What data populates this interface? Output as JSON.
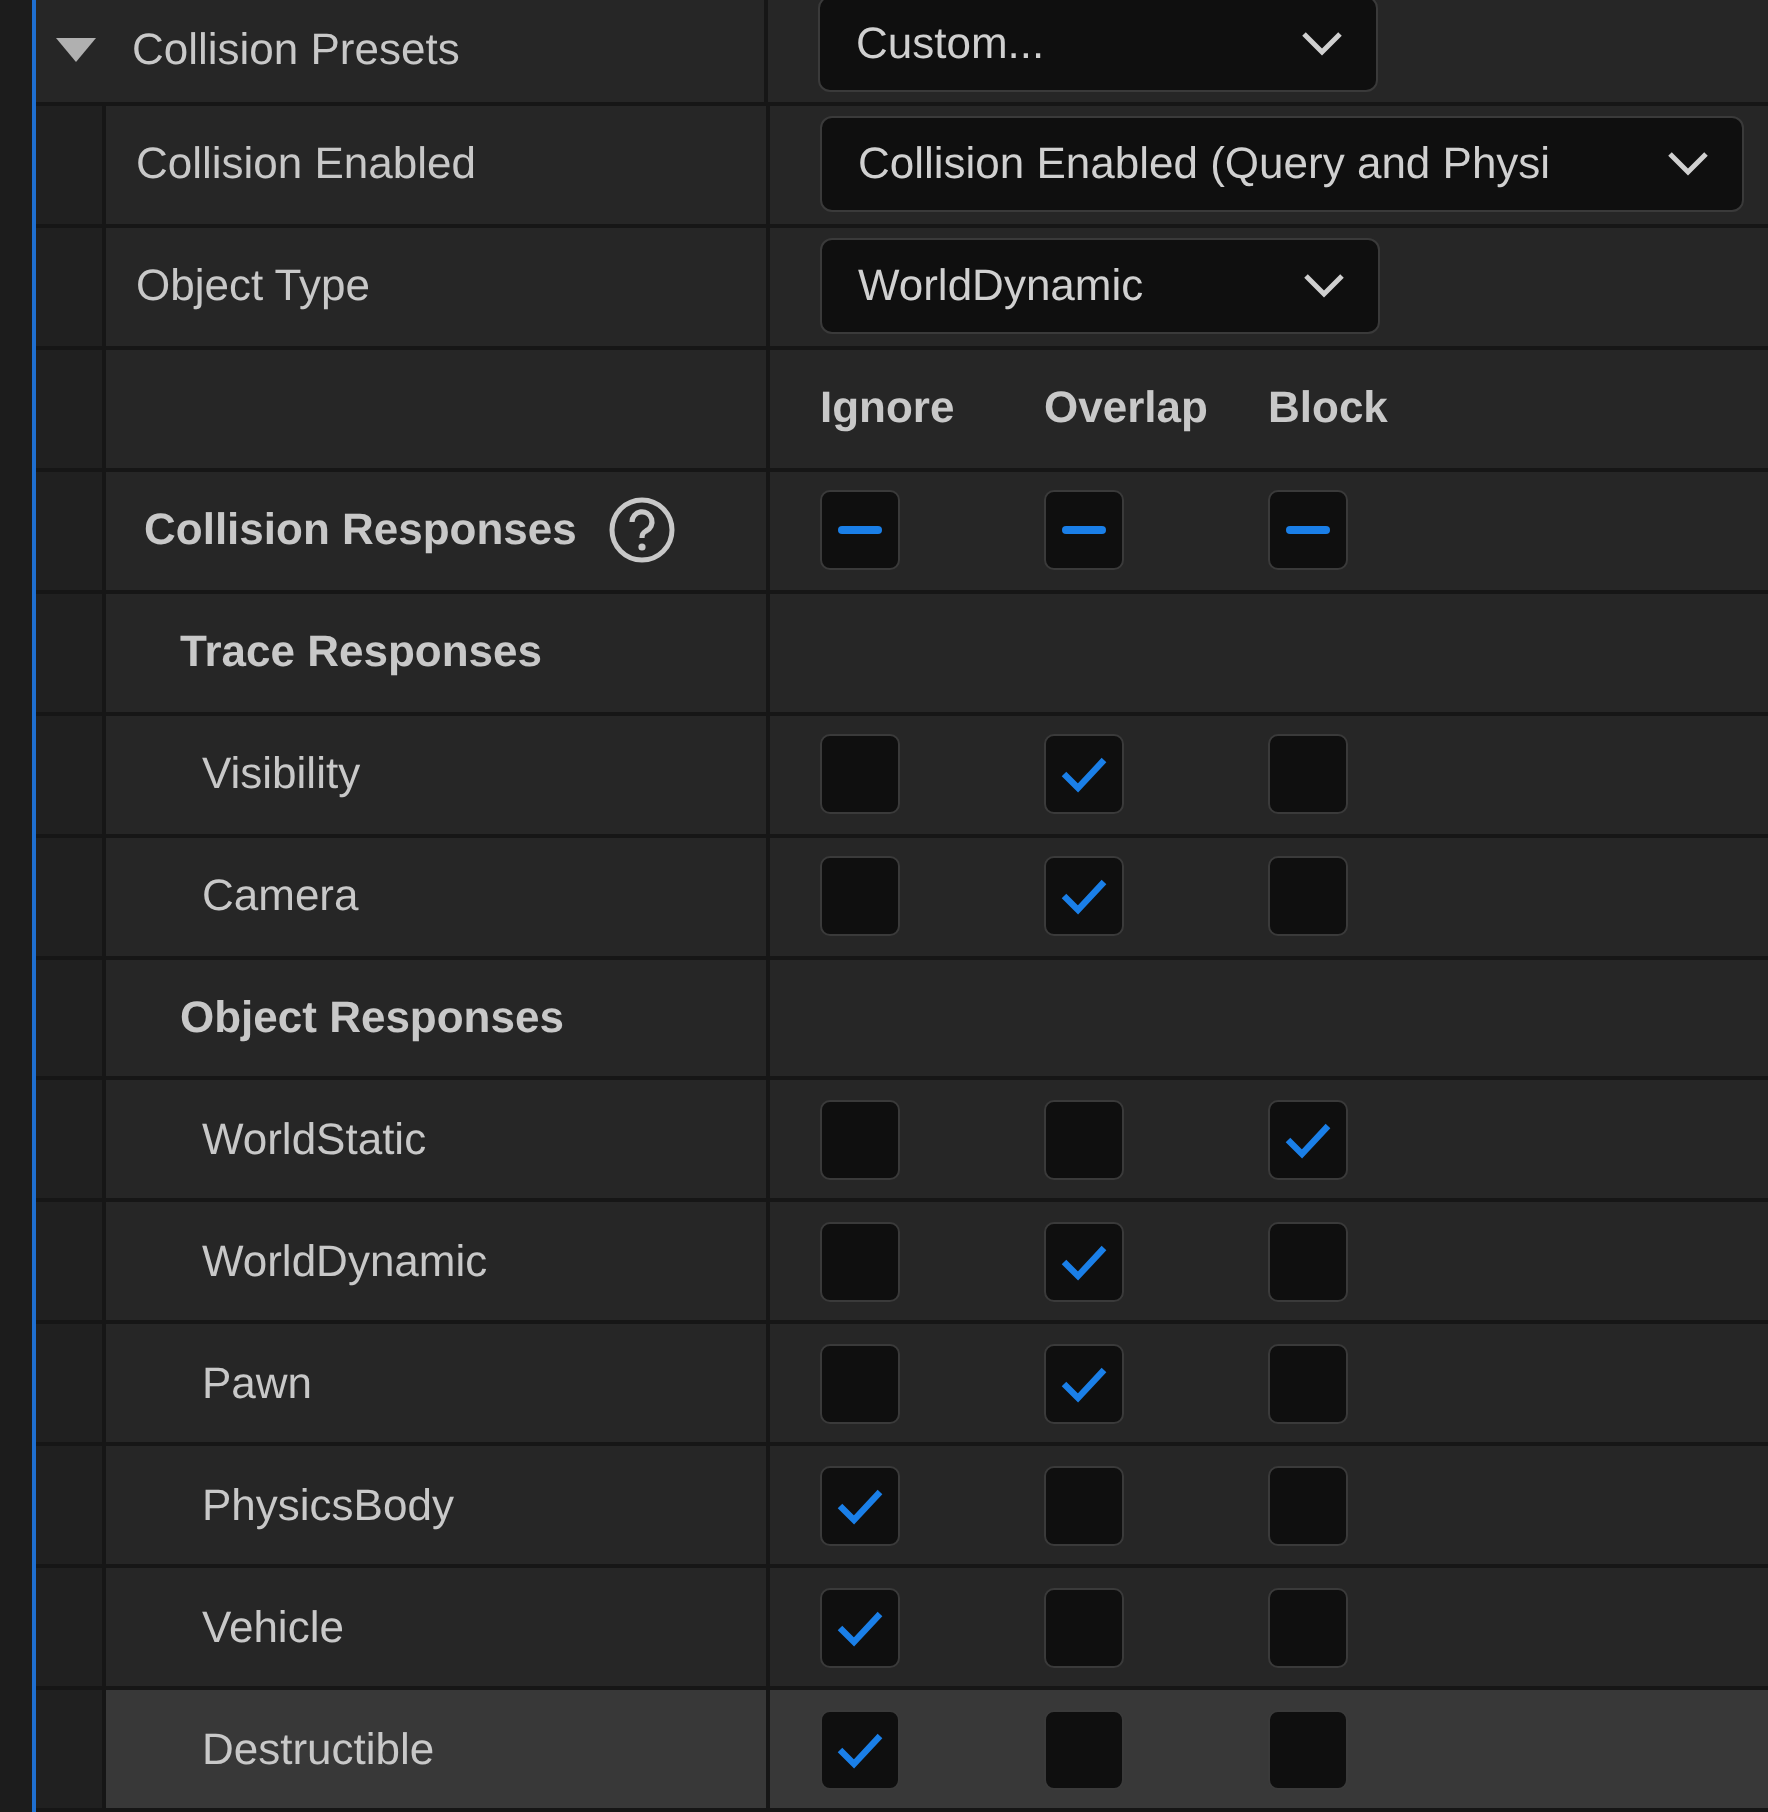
{
  "presets": {
    "label": "Collision Presets",
    "expanded": true,
    "value": "Custom..."
  },
  "properties": [
    {
      "label": "Collision Enabled",
      "value": "Collision Enabled (Query and Physi"
    },
    {
      "label": "Object Type",
      "value": "WorldDynamic"
    }
  ],
  "columns": [
    "Ignore",
    "Overlap",
    "Block"
  ],
  "responses": {
    "label": "Collision Responses",
    "mixed": [
      true,
      true,
      true
    ]
  },
  "groups": [
    {
      "title": "Trace Responses",
      "rows": [
        {
          "label": "Visibility",
          "highlighted": false,
          "checks": [
            false,
            true,
            false
          ]
        },
        {
          "label": "Camera",
          "highlighted": false,
          "checks": [
            false,
            true,
            false
          ]
        }
      ]
    },
    {
      "title": "Object Responses",
      "rows": [
        {
          "label": "WorldStatic",
          "highlighted": false,
          "checks": [
            false,
            false,
            true
          ]
        },
        {
          "label": "WorldDynamic",
          "highlighted": false,
          "checks": [
            false,
            true,
            false
          ]
        },
        {
          "label": "Pawn",
          "highlighted": false,
          "checks": [
            false,
            true,
            false
          ]
        },
        {
          "label": "PhysicsBody",
          "highlighted": false,
          "checks": [
            true,
            false,
            false
          ]
        },
        {
          "label": "Vehicle",
          "highlighted": false,
          "checks": [
            true,
            false,
            false
          ]
        },
        {
          "label": "Destructible",
          "highlighted": true,
          "checks": [
            true,
            false,
            false
          ]
        }
      ]
    }
  ]
}
